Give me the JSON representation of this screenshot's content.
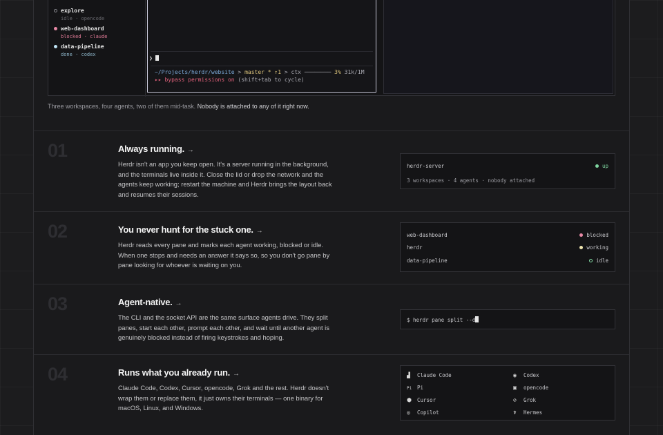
{
  "workspaces": [
    {
      "name": "explore",
      "status": "idle · opencode",
      "dot": "#6a6a70"
    },
    {
      "name": "web-dashboard",
      "status": "blocked · claude",
      "dot": "#e889a6"
    },
    {
      "name": "data-pipeline",
      "status": "done · codex",
      "dot": "#bfe3f5"
    }
  ],
  "terminal": {
    "prompt": "❯",
    "path": "~/Projects/herdr/website",
    "sep1": ">",
    "branch": "master * ↑1",
    "sep2": "> ctx",
    "ctx_bar": "────────",
    "ctx_pct": "3%",
    "ctx_tokens": "31k/1M",
    "bypass_prefix": "▸▸ bypass permissions on",
    "bypass_suffix": "(shift+tab to cycle)"
  },
  "caption": {
    "lead": "Three workspaces, four agents, two of them mid-task.",
    "tail": "Nobody is attached to any of it right now."
  },
  "features": [
    {
      "num": "01",
      "title": "Always running.",
      "arrow": "→",
      "body": "Herdr isn't an app you keep open. It's a server running in the background, and the terminals live inside it. Close the lid or drop the network and the agents keep working; restart the machine and Herdr brings the layout back and resumes their sessions."
    },
    {
      "num": "02",
      "title": "You never hunt for the stuck one.",
      "arrow": "→",
      "body": "Herdr reads every pane and marks each agent working, blocked or idle. When one stops and needs an answer it says so, so you don't go pane by pane looking for whoever is waiting on you."
    },
    {
      "num": "03",
      "title": "Agent-native.",
      "arrow": "→",
      "body": "The CLI and the socket API are the same surface agents drive. They split panes, start each other, prompt each other, and wait until another agent is genuinely blocked instead of firing keystrokes and hoping."
    },
    {
      "num": "04",
      "title": "Runs what you already run.",
      "arrow": "→",
      "body": "Claude Code, Codex, Cursor, opencode, Grok and the rest. Herdr doesn't wrap them or replace them, it just owns their terminals — one binary for macOS, Linux, and Windows."
    }
  ],
  "server_card": {
    "name": "herdr-server",
    "status": "up",
    "status_color": "#7fd6a0",
    "summary": "3 workspaces · 4 agents · nobody attached"
  },
  "status_card": [
    {
      "name": "web-dashboard",
      "status": "blocked",
      "color": "#e889a6"
    },
    {
      "name": "herdr",
      "status": "working",
      "color": "#f0e6b0"
    },
    {
      "name": "data-pipeline",
      "status": "idle",
      "color": "#7fd6a0"
    }
  ],
  "cli_card": {
    "prompt": "$",
    "command": "herdr pane split --d"
  },
  "agents": [
    {
      "name": "Claude Code",
      "icon": "claude-icon",
      "glyph": "▟"
    },
    {
      "name": "Codex",
      "icon": "codex-icon",
      "glyph": "◉"
    },
    {
      "name": "Pi",
      "icon": "pi-icon",
      "glyph": "Pi"
    },
    {
      "name": "opencode",
      "icon": "opencode-icon",
      "glyph": "▣"
    },
    {
      "name": "Cursor",
      "icon": "cursor-icon",
      "glyph": "⬢"
    },
    {
      "name": "Grok",
      "icon": "grok-icon",
      "glyph": "⊘"
    },
    {
      "name": "Copilot",
      "icon": "copilot-icon",
      "glyph": "◎"
    },
    {
      "name": "Hermes",
      "icon": "hermes-icon",
      "glyph": "☤"
    }
  ]
}
